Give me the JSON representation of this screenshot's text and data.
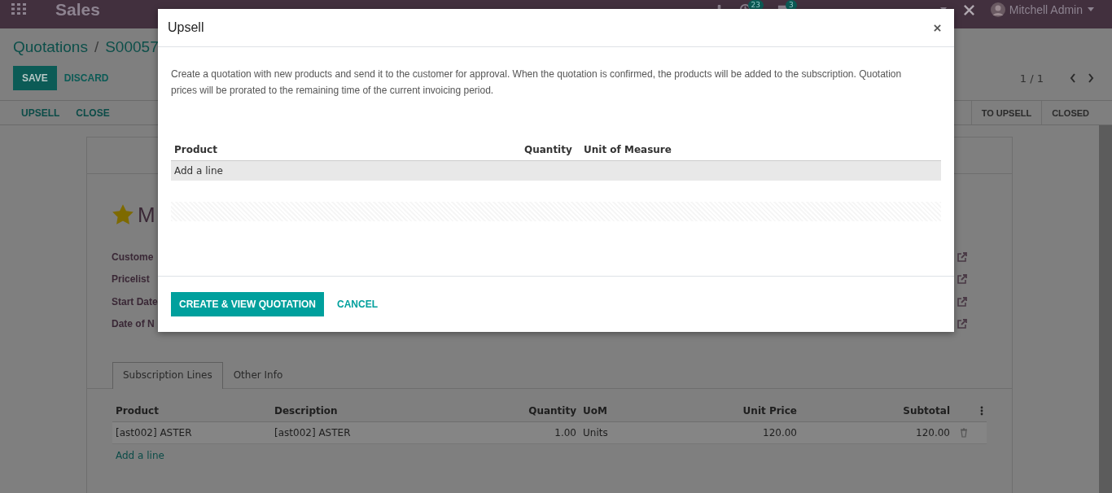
{
  "navbar": {
    "app_name": "Sales",
    "activity_count": "23",
    "message_count": "3",
    "user": "Mitchell Admin"
  },
  "breadcrumb": {
    "items": [
      "Quotations",
      "S00057"
    ],
    "separator": "/"
  },
  "buttons": {
    "save": "SAVE",
    "discard": "DISCARD"
  },
  "pager": "1 / 1",
  "actions": [
    "UPSELL",
    "CLOSE"
  ],
  "stages": [
    "TO UPSELL",
    "CLOSED"
  ],
  "form": {
    "starred": true,
    "title": "M",
    "fields": [
      "Custome",
      "Pricelist",
      "Start Date",
      "Date of N"
    ]
  },
  "tabs": [
    {
      "label": "Subscription Lines",
      "selected": true
    },
    {
      "label": "Other Info",
      "selected": false
    }
  ],
  "lines": {
    "columns": [
      "Product",
      "Description",
      "Quantity",
      "UoM",
      "Unit Price",
      "Subtotal"
    ],
    "rows": [
      [
        "[ast002] ASTER",
        "[ast002] ASTER",
        "1.00",
        "Units",
        "120.00",
        "120.00"
      ]
    ],
    "add_line": "Add a line"
  },
  "dialog": {
    "title": "Upsell",
    "description": "Create a quotation with new products and send it to the customer for approval. When the quotation is confirmed, the products will be added to the subscription. Quotation prices will be prorated to the remaining time of the current invoicing period.",
    "columns": [
      "Product",
      "Quantity",
      "Unit of Measure"
    ],
    "add_line": "Add a line",
    "buttons": [
      {
        "label": "CREATE & VIEW QUOTATION",
        "kind": "primary"
      },
      {
        "label": "CANCEL",
        "kind": "link"
      }
    ]
  }
}
